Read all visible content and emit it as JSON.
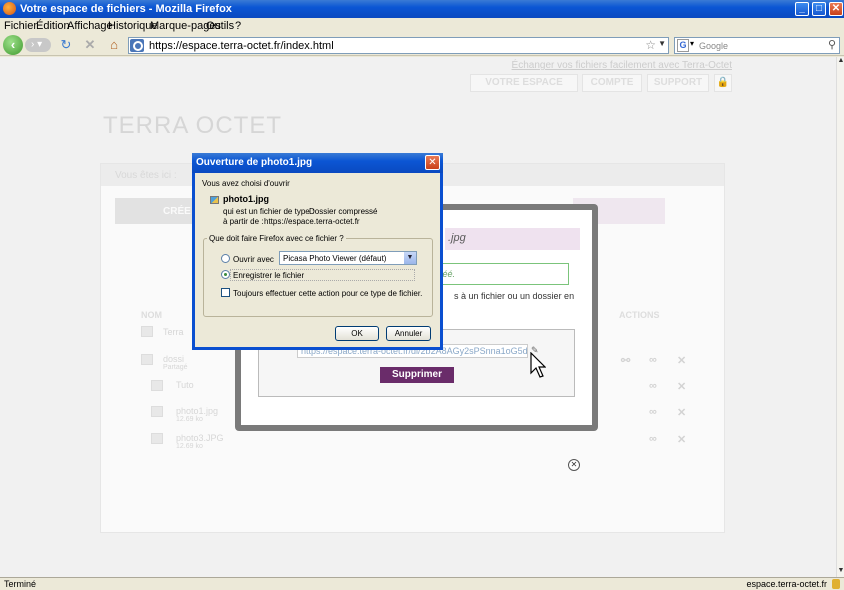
{
  "window": {
    "title": "Votre espace de fichiers - Mozilla Firefox",
    "min": "_",
    "max": "□",
    "close": "✕"
  },
  "menu": [
    "Fichier",
    "Édition",
    "Affichage",
    "Historique",
    "Marque-pages",
    "Outils",
    "?"
  ],
  "nav": {
    "url": "https://espace.terra-octet.fr/index.html",
    "search_placeholder": "Google",
    "search_engine": "G"
  },
  "page": {
    "topline": "Échanger vos fichiers facilement avec Terra-Octet",
    "topnav": [
      "VOTRE ESPACE",
      "COMPTE",
      "SUPPORT"
    ],
    "logo": "TERRA OCTET",
    "breadcrumb": "Vous êtes ici :",
    "create_label": "CRÉE",
    "columns": {
      "name": "NOM",
      "actions": "ACTIONS"
    },
    "rows": [
      {
        "name": "Terra",
        "sub": ""
      },
      {
        "name": "dossi",
        "sub": "Partagé"
      },
      {
        "name": "Tuto",
        "sub": ""
      },
      {
        "name": "photo1.jpg",
        "sub": "12.69 ko"
      },
      {
        "name": "photo3.JPG",
        "sub": "12.69 ko"
      }
    ]
  },
  "share_modal": {
    "title": ".jpg",
    "status": "créé.",
    "message": "s à un fichier ou un dossier en",
    "link": "https://espace.terra-octet.fr/dl/2b2A8AGy2sPSnna1oG5dvb",
    "delete_label": "Supprimer",
    "close": "✕"
  },
  "dialog": {
    "title": "Ouverture de photo1.jpg",
    "intro": "Vous avez choisi d'ouvrir",
    "filename": "photo1.jpg",
    "type_label": "qui est un fichier de type :",
    "type_value": "Dossier compressé",
    "from_label": "à partir de :",
    "from_value": "https://espace.terra-octet.fr",
    "group_label": "Que doit faire Firefox avec ce fichier ?",
    "open_with_label": "Ouvrir avec",
    "open_with_value": "Picasa Photo Viewer (défaut)",
    "save_label": "Enregistrer le fichier",
    "always_label": "Toujours effectuer cette action pour ce type de fichier.",
    "ok": "OK",
    "cancel": "Annuler",
    "open_with_selected": false,
    "save_selected": true,
    "always_checked": false
  },
  "status": {
    "left": "Terminé",
    "right": "espace.terra-octet.fr"
  }
}
